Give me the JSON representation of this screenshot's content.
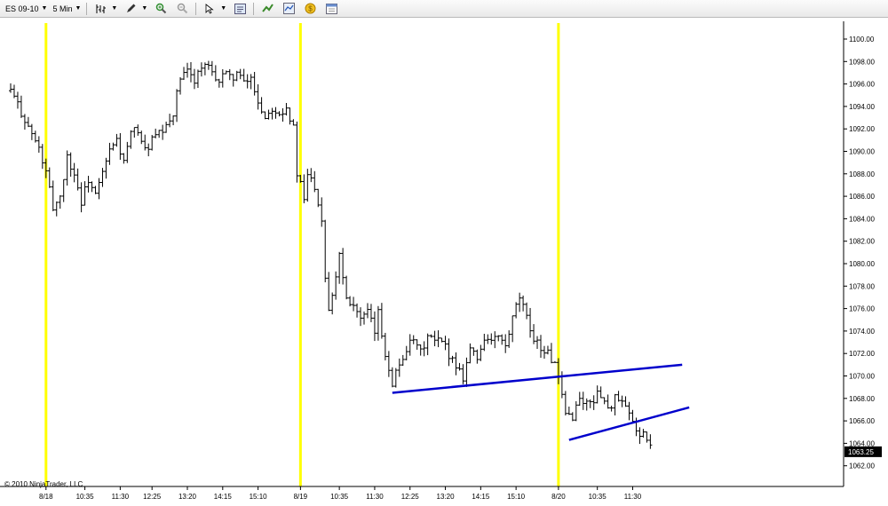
{
  "toolbar": {
    "instrument": "ES 09-10",
    "interval": "5 Min"
  },
  "copyright": "© 2010 NinjaTrader, LLC",
  "last_price_label": "1063.25",
  "colors": {
    "session_line": "#ffff00",
    "trendline": "#0000cc",
    "bar": "#000000",
    "price_marker": "#000000"
  },
  "icons": [
    "bars-icon",
    "pencil-icon",
    "zoom-in-icon",
    "zoom-out-icon",
    "pointer-icon",
    "properties-icon",
    "indicators-icon",
    "strategies-icon",
    "data-icon",
    "chart-trader-icon"
  ],
  "chart_data": {
    "type": "ohlc",
    "yticks": [
      1100,
      1098,
      1096,
      1094,
      1092,
      1090,
      1088,
      1086,
      1084,
      1082,
      1080,
      1078,
      1076,
      1074,
      1072,
      1070,
      1068,
      1066,
      1064,
      1062
    ],
    "ytick_labels": [
      "1100.00",
      "1098.00",
      "1096.00",
      "1094.00",
      "1092.00",
      "1090.00",
      "1088.00",
      "1086.00",
      "1084.00",
      "1082.00",
      "1080.00",
      "1078.00",
      "1076.00",
      "1074.00",
      "1072.00",
      "1070.00",
      "1068.00",
      "1066.00",
      "1064.00",
      "1062.00"
    ],
    "ylim": [
      1061,
      1101
    ],
    "xlim": [
      0,
      197
    ],
    "xtick_labels": [
      {
        "bar": 10,
        "label": "8/18"
      },
      {
        "bar": 21,
        "label": "10:35"
      },
      {
        "bar": 31,
        "label": "11:30"
      },
      {
        "bar": 40,
        "label": "12:25"
      },
      {
        "bar": 50,
        "label": "13:20"
      },
      {
        "bar": 60,
        "label": "14:15"
      },
      {
        "bar": 70,
        "label": "15:10"
      },
      {
        "bar": 82,
        "label": "8/19"
      },
      {
        "bar": 93,
        "label": "10:35"
      },
      {
        "bar": 103,
        "label": "11:30"
      },
      {
        "bar": 113,
        "label": "12:25"
      },
      {
        "bar": 123,
        "label": "13:20"
      },
      {
        "bar": 133,
        "label": "14:15"
      },
      {
        "bar": 143,
        "label": "15:10"
      },
      {
        "bar": 155,
        "label": "8/20"
      },
      {
        "bar": 166,
        "label": "10:35"
      },
      {
        "bar": 176,
        "label": "11:30"
      }
    ],
    "session_breaks": [
      10,
      82,
      155
    ],
    "trendlines": [
      {
        "x1": 108,
        "y1": 1068.5,
        "x2": 190,
        "y2": 1071.0
      },
      {
        "x1": 158,
        "y1": 1064.3,
        "x2": 192,
        "y2": 1067.2
      }
    ],
    "last_price": 1063.25,
    "path": [
      [
        0,
        1095.4
      ],
      [
        3,
        1093.5
      ],
      [
        6,
        1091.5
      ],
      [
        8,
        1090.2
      ],
      [
        10,
        1088.0
      ],
      [
        12,
        1085.0
      ],
      [
        14,
        1086.0
      ],
      [
        16,
        1089.5
      ],
      [
        18,
        1088.0
      ],
      [
        20,
        1085.5
      ],
      [
        22,
        1087.5
      ],
      [
        24,
        1086.0
      ],
      [
        26,
        1088.0
      ],
      [
        28,
        1090.0
      ],
      [
        30,
        1091.0
      ],
      [
        32,
        1089.0
      ],
      [
        34,
        1091.5
      ],
      [
        36,
        1092.0
      ],
      [
        38,
        1090.0
      ],
      [
        40,
        1091.0
      ],
      [
        42,
        1091.5
      ],
      [
        44,
        1092.0
      ],
      [
        46,
        1093.5
      ],
      [
        48,
        1096.5
      ],
      [
        50,
        1097.0
      ],
      [
        52,
        1096.5
      ],
      [
        54,
        1097.5
      ],
      [
        56,
        1097.5
      ],
      [
        58,
        1096.0
      ],
      [
        60,
        1097.0
      ],
      [
        62,
        1096.5
      ],
      [
        64,
        1097.0
      ],
      [
        66,
        1096.0
      ],
      [
        68,
        1096.5
      ],
      [
        70,
        1094.5
      ],
      [
        72,
        1093.0
      ],
      [
        74,
        1094.0
      ],
      [
        76,
        1093.5
      ],
      [
        78,
        1094.0
      ],
      [
        80,
        1092.0
      ],
      [
        81,
        1088.0
      ],
      [
        82,
        1087.0
      ],
      [
        83,
        1085.5
      ],
      [
        84,
        1088.0
      ],
      [
        86,
        1087.0
      ],
      [
        88,
        1084.0
      ],
      [
        89,
        1079.0
      ],
      [
        90,
        1076.0
      ],
      [
        92,
        1079.0
      ],
      [
        93,
        1081.0
      ],
      [
        95,
        1077.0
      ],
      [
        97,
        1076.5
      ],
      [
        99,
        1075.0
      ],
      [
        101,
        1075.5
      ],
      [
        103,
        1074.0
      ],
      [
        104,
        1075.5
      ],
      [
        106,
        1072.0
      ],
      [
        108,
        1069.5
      ],
      [
        110,
        1071.0
      ],
      [
        112,
        1072.5
      ],
      [
        114,
        1073.0
      ],
      [
        116,
        1072.0
      ],
      [
        118,
        1073.5
      ],
      [
        120,
        1073.0
      ],
      [
        122,
        1073.0
      ],
      [
        124,
        1072.0
      ],
      [
        126,
        1071.0
      ],
      [
        128,
        1070.0
      ],
      [
        130,
        1072.5
      ],
      [
        132,
        1071.5
      ],
      [
        134,
        1073.5
      ],
      [
        136,
        1073.0
      ],
      [
        138,
        1073.5
      ],
      [
        140,
        1072.5
      ],
      [
        142,
        1075.0
      ],
      [
        144,
        1077.0
      ],
      [
        146,
        1075.0
      ],
      [
        148,
        1073.5
      ],
      [
        150,
        1072.5
      ],
      [
        152,
        1072.0
      ],
      [
        154,
        1071.0
      ],
      [
        156,
        1068.0
      ],
      [
        157,
        1066.5
      ],
      [
        159,
        1066.5
      ],
      [
        161,
        1068.0
      ],
      [
        163,
        1067.5
      ],
      [
        165,
        1068.0
      ],
      [
        167,
        1068.5
      ],
      [
        169,
        1067.0
      ],
      [
        171,
        1068.0
      ],
      [
        173,
        1067.5
      ],
      [
        175,
        1066.5
      ],
      [
        177,
        1065.0
      ],
      [
        179,
        1065.0
      ],
      [
        181,
        1063.5
      ]
    ]
  }
}
